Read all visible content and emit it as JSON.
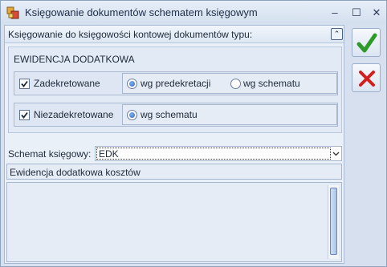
{
  "window": {
    "title": "Księgowanie dokumentów schematem księgowym",
    "minimize": "–",
    "maximize": "☐",
    "close": "✕"
  },
  "header": {
    "label": "Księgowanie do księgowości kontowej dokumentów typu:",
    "collapse": "⌃"
  },
  "section": {
    "title": "EWIDENCJA DODATKOWA",
    "rows": [
      {
        "checkbox_label": "Zadekretowane",
        "checked": true,
        "options": [
          {
            "label": "wg predekretacji",
            "selected": true
          },
          {
            "label": "wg schematu",
            "selected": false
          }
        ]
      },
      {
        "checkbox_label": "Niezadekretowane",
        "checked": true,
        "options": [
          {
            "label": "wg schematu",
            "selected": true
          }
        ]
      }
    ]
  },
  "schema": {
    "label": "Schemat księgowy:",
    "value": "EDK",
    "description": "Ewidencja dodatkowa kosztów"
  },
  "actions": {
    "ok_icon": "check-icon",
    "cancel_icon": "cross-icon"
  },
  "colors": {
    "ok": "#2e9a2a",
    "cancel": "#d21f1f",
    "accent": "#2d66b5"
  }
}
